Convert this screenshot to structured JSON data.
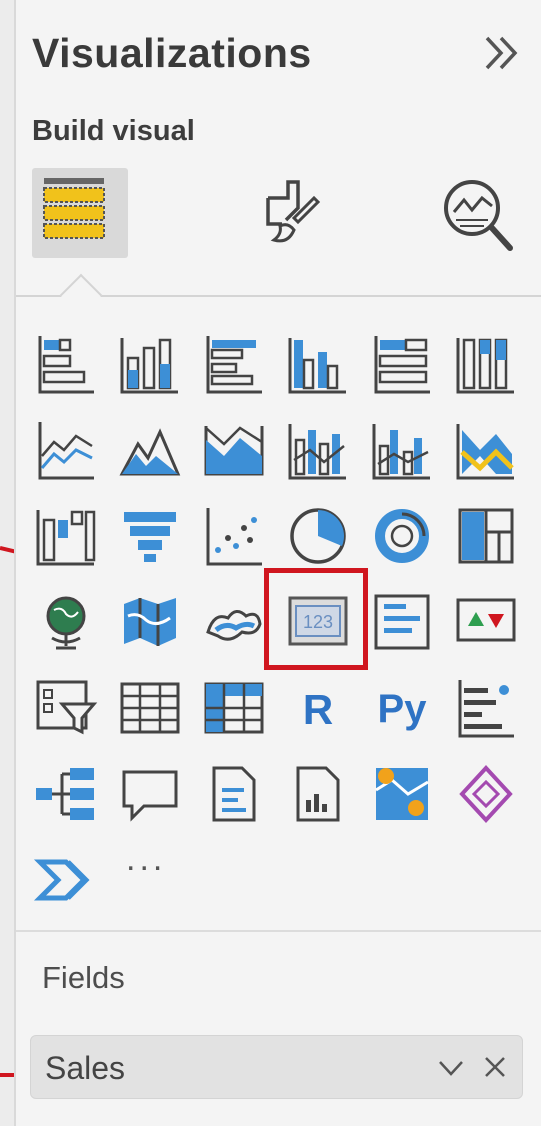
{
  "pane": {
    "title": "Visualizations",
    "subtitle": "Build visual",
    "fields_label": "Fields"
  },
  "build_modes": [
    {
      "name": "build-visual-mode",
      "icon": "table-fields-icon",
      "selected": true
    },
    {
      "name": "format-visual-mode",
      "icon": "paintbrush-format-icon",
      "selected": false
    },
    {
      "name": "analytics-mode",
      "icon": "magnifier-analytics-icon",
      "selected": false
    }
  ],
  "visuals": [
    [
      "stacked-bar-chart-icon",
      "stacked-column-chart-icon",
      "clustered-bar-chart-icon",
      "clustered-column-chart-icon",
      "100-stacked-bar-chart-icon",
      "100-stacked-column-chart-icon"
    ],
    [
      "line-chart-icon",
      "area-chart-icon",
      "stacked-area-chart-icon",
      "line-and-stacked-column-icon",
      "line-and-clustered-column-icon",
      "ribbon-chart-icon"
    ],
    [
      "waterfall-chart-icon",
      "funnel-chart-icon",
      "scatter-chart-icon",
      "pie-chart-icon",
      "donut-chart-icon",
      "treemap-icon"
    ],
    [
      "map-globe-icon",
      "filled-map-icon",
      "shape-map-icon",
      "card-icon",
      "multi-row-card-icon",
      "kpi-icon"
    ],
    [
      "slicer-icon",
      "table-icon",
      "matrix-icon",
      "r-visual-icon",
      "python-visual-icon",
      "key-influencers-icon"
    ],
    [
      "decomposition-tree-icon",
      "qna-icon",
      "smart-narrative-icon",
      "paginated-report-icon",
      "azure-map-icon",
      "power-apps-icon"
    ],
    [
      "power-automate-icon"
    ]
  ],
  "text_glyphs": {
    "card_value": "123",
    "r_label": "R",
    "py_label": "Py",
    "more": "..."
  },
  "field_well": {
    "value": "Sales"
  },
  "colors": {
    "accent_blue": "#3d8fd6",
    "accent_yellow": "#f1c21b",
    "highlight_red": "#d0161f"
  }
}
